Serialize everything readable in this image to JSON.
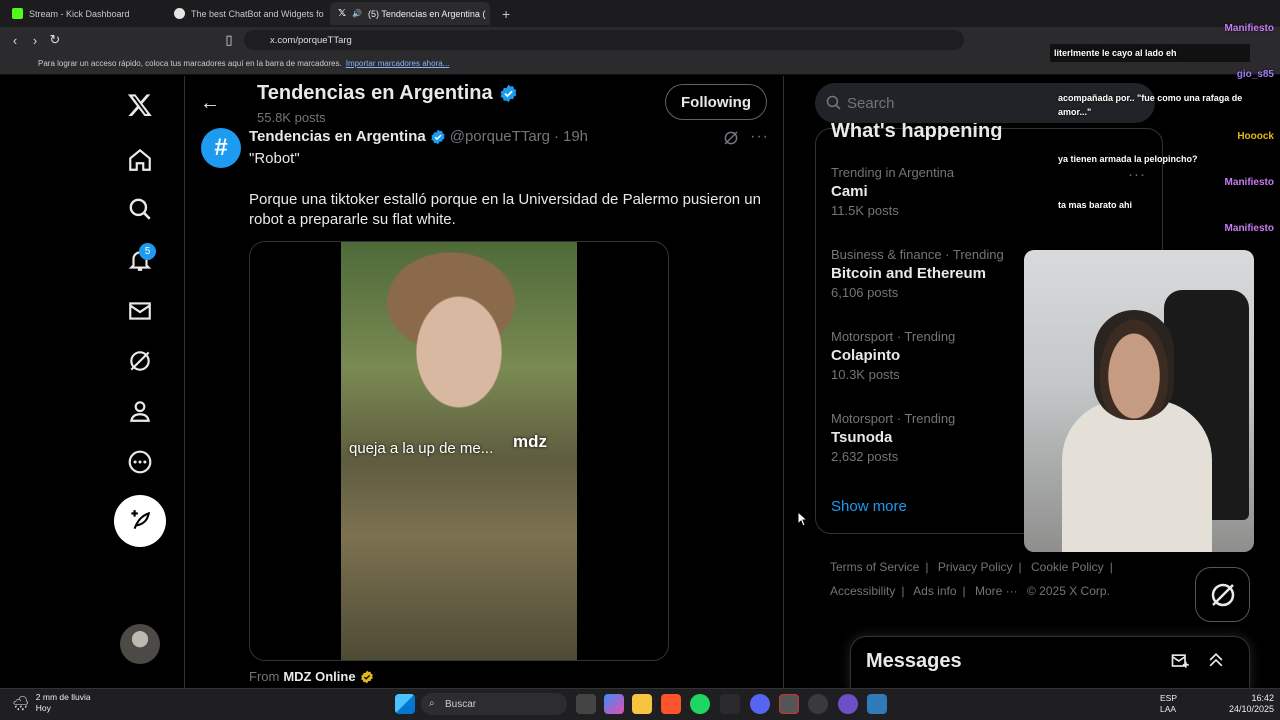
{
  "browser": {
    "tabs": [
      {
        "title": "Stream - Kick Dashboard",
        "color": "#53fc18"
      },
      {
        "title": "The best ChatBot and Widgets for Ki",
        "color": "#e5e5e5"
      },
      {
        "title": "(5) Tendencias en Argentina (",
        "color": "#ffffff"
      }
    ],
    "url": "x.com/porqueTTarg",
    "bookmarks_text": "Para lograr un acceso rápido, coloca tus marcadores aquí en la barra de marcadores.",
    "bookmarks_link": "Importar marcadores ahora..."
  },
  "nav": {
    "notifications_badge": "5"
  },
  "header": {
    "title": "Tendencias en Argentina",
    "subtitle": "55.8K posts",
    "follow_label": "Following"
  },
  "post": {
    "avatar_glyph": "#",
    "name": "Tendencias en Argentina",
    "handle": "@porqueTTarg",
    "time": "19h",
    "text1": "\"Robot\"",
    "text2": "Porque una tiktoker estalló porque en la Universidad de Palermo pusieron un robot a prepararle su flat white.",
    "video_caption": "queja a la up de me...",
    "video_logo": "mdz",
    "from_prefix": "From",
    "from_source": "MDZ Online"
  },
  "sidebar": {
    "search_placeholder": "Search",
    "trends_title": "What's happening",
    "trends": [
      {
        "context": "Trending in Argentina",
        "name": "Cami",
        "count": "11.5K posts"
      },
      {
        "context": "Business & finance · Trending",
        "name": "Bitcoin and Ethereum",
        "count": "6,106 posts"
      },
      {
        "context": "Motorsport · Trending",
        "name": "Colapinto",
        "count": "10.3K posts"
      },
      {
        "context": "Motorsport · Trending",
        "name": "Tsunoda",
        "count": "2,632 posts"
      }
    ],
    "show_more": "Show more",
    "footer": [
      "Terms of Service",
      "Privacy Policy",
      "Cookie Policy",
      "Accessibility",
      "Ads info",
      "More ···",
      "© 2025 X Corp."
    ],
    "messages_title": "Messages"
  },
  "chat": {
    "messages": [
      "literlmente le cayo al lado eh",
      "acompañada por.. \"fue como una rafaga de amor...\"",
      "ya tienen armada la pelopincho?",
      "ta mas barato ahi"
    ],
    "users": [
      {
        "name": "Manifiesto",
        "color": "#c67cf2"
      },
      {
        "name": "gio_s85",
        "color": "#9f7cf2"
      },
      {
        "name": "Hooock",
        "color": "#c67cf2"
      },
      {
        "name": "Manifiesto",
        "color": "#c67cf2"
      },
      {
        "name": "Manifiesto",
        "color": "#c67cf2"
      }
    ]
  },
  "taskbar": {
    "weather_line1": "2 mm de lluvia",
    "weather_line2": "Hoy",
    "search_label": "Buscar",
    "lang_line1": "ESP",
    "lang_line2": "LAA",
    "time": "16:42",
    "date": "24/10/2025"
  }
}
